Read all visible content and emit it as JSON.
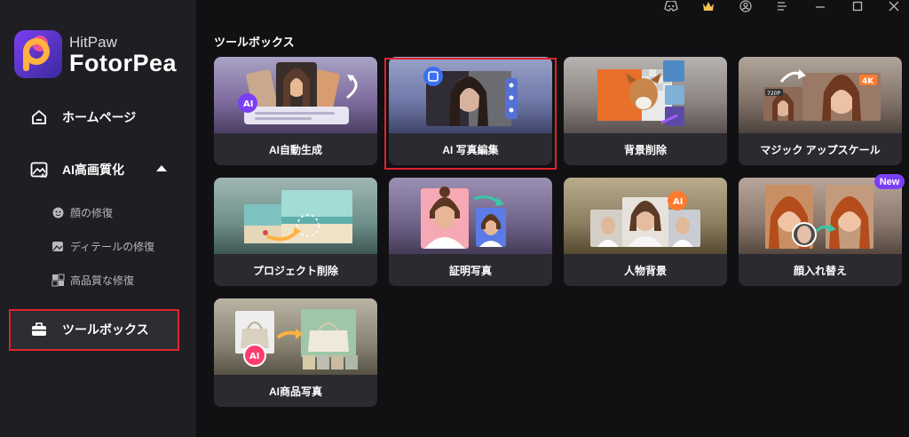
{
  "app": {
    "brand_sub": "HitPaw",
    "brand_main": "FotorPea"
  },
  "sidebar": {
    "home": "ホームページ",
    "enhance": "AI高画質化",
    "sub": [
      "顔の修復",
      "ディテールの修復",
      "高品質な修復"
    ],
    "toolbox": "ツールボックス"
  },
  "main": {
    "section_title": "ツールボックス",
    "cards": [
      {
        "label": "AI自動生成"
      },
      {
        "label": "AI 写真編集"
      },
      {
        "label": "背景削除"
      },
      {
        "label": "マジック アップスケール"
      },
      {
        "label": "プロジェクト削除"
      },
      {
        "label": "証明写真"
      },
      {
        "label": "人物背景"
      },
      {
        "label": "顔入れ替え"
      },
      {
        "label": "AI商品写真"
      }
    ],
    "badge_new": "New",
    "thumb_text": {
      "ai": "AI",
      "res_low": "720P",
      "res_high": "4K"
    }
  },
  "colors": {
    "accent": "#7a3ff5",
    "highlight": "#e0232e",
    "sidebar_bg": "#1e1e23",
    "card_bg": "#2a2a30"
  },
  "icons": [
    "discord-icon",
    "crown-icon",
    "user-icon",
    "menu-icon",
    "minimize-icon",
    "maximize-icon",
    "close-icon"
  ]
}
